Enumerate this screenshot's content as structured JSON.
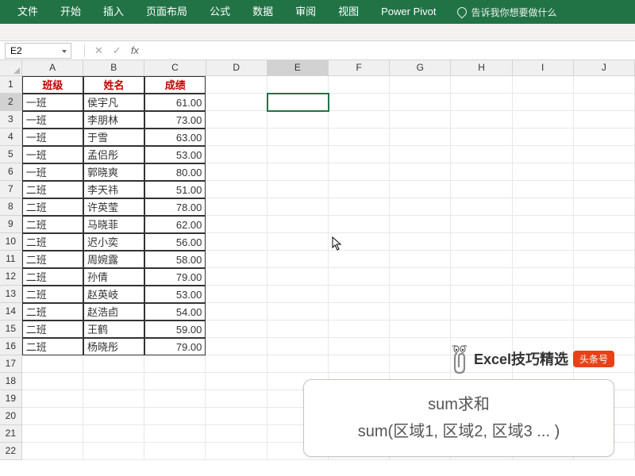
{
  "ribbon": {
    "tabs": [
      "文件",
      "开始",
      "插入",
      "页面布局",
      "公式",
      "数据",
      "审阅",
      "视图",
      "Power Pivot"
    ],
    "tellMe": "告诉我你想要做什么"
  },
  "formulaBar": {
    "nameBox": "E2"
  },
  "columns": [
    "A",
    "B",
    "C",
    "D",
    "E",
    "F",
    "G",
    "H",
    "I",
    "J"
  ],
  "activeCol": 4,
  "activeRow": 2,
  "header": {
    "A": "班级",
    "B": "姓名",
    "C": "成绩"
  },
  "rows": [
    {
      "A": "一班",
      "B": "侯宇凡",
      "C": "61.00"
    },
    {
      "A": "一班",
      "B": "李朋林",
      "C": "73.00"
    },
    {
      "A": "一班",
      "B": "于雪",
      "C": "63.00"
    },
    {
      "A": "一班",
      "B": "孟侣彤",
      "C": "53.00"
    },
    {
      "A": "一班",
      "B": "郭晓爽",
      "C": "80.00"
    },
    {
      "A": "二班",
      "B": "李天祎",
      "C": "51.00"
    },
    {
      "A": "二班",
      "B": "许英莹",
      "C": "78.00"
    },
    {
      "A": "二班",
      "B": "马晓菲",
      "C": "62.00"
    },
    {
      "A": "二班",
      "B": "迟小奕",
      "C": "56.00"
    },
    {
      "A": "二班",
      "B": "周婉露",
      "C": "58.00"
    },
    {
      "A": "二班",
      "B": "孙倩",
      "C": "79.00"
    },
    {
      "A": "二班",
      "B": "赵英岐",
      "C": "53.00"
    },
    {
      "A": "二班",
      "B": "赵浩卣",
      "C": "54.00"
    },
    {
      "A": "二班",
      "B": "王鹤",
      "C": "59.00"
    },
    {
      "A": "二班",
      "B": "杨晓彤",
      "C": "79.00"
    }
  ],
  "emptyRows": 6,
  "tip": {
    "title": "Excel技巧精选",
    "badge": "头条号",
    "line1": "sum求和",
    "line2": "sum(区域1, 区域2, 区域3 ... )"
  }
}
